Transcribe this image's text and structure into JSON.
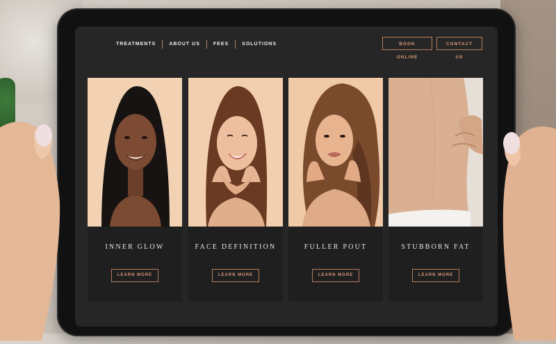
{
  "nav": {
    "links": [
      "TREATMENTS",
      "ABOUT US",
      "FEES",
      "SOLUTIONS"
    ],
    "book_online": "BOOK ONLINE",
    "contact_us": "CONTACT US"
  },
  "cards": [
    {
      "title": "INNER GLOW",
      "button": "LEARN MORE"
    },
    {
      "title": "FACE DEFINITION",
      "button": "LEARN MORE"
    },
    {
      "title": "FULLER POUT",
      "button": "LEARN MORE"
    },
    {
      "title": "STUBBORN FAT",
      "button": "LEARN MORE"
    }
  ],
  "colors": {
    "accent": "#b87d5c",
    "screen_bg": "#262626",
    "card_bg": "#1f1f1f",
    "text": "#efe9e2"
  }
}
